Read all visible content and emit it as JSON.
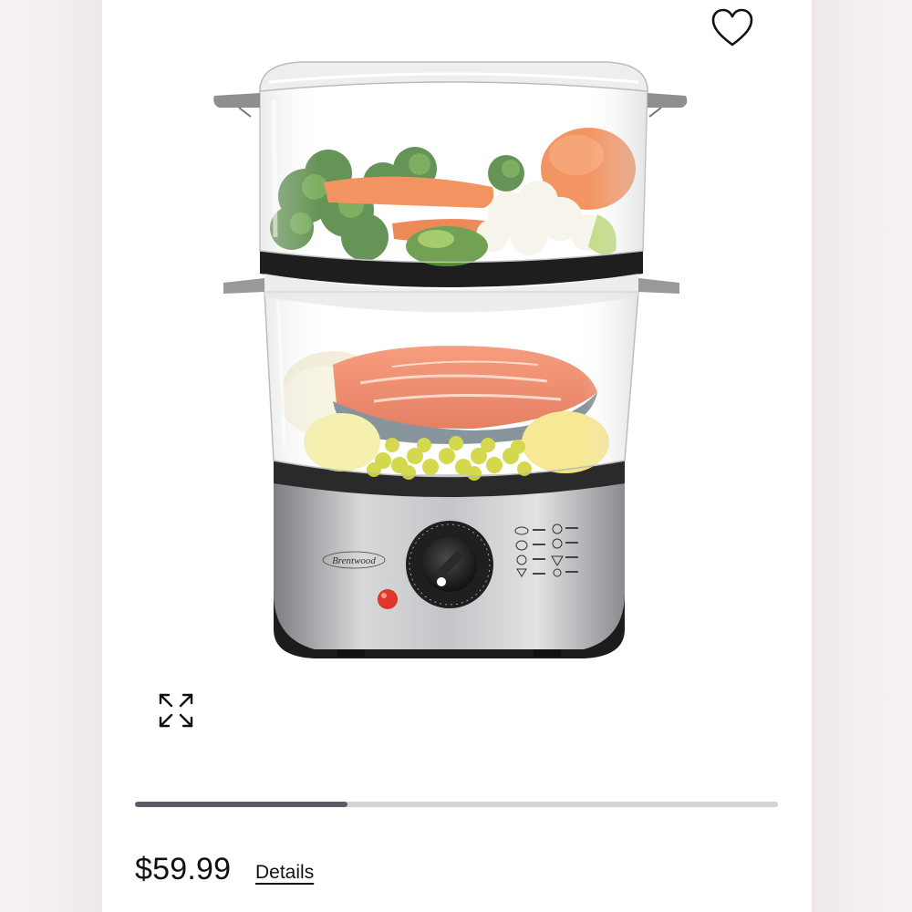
{
  "product": {
    "price": "$59.99",
    "details_label": "Details",
    "brand_text": "Brentwood",
    "image_progress_fraction": 0.33
  },
  "icons": {
    "favorite": "heart-outline-icon",
    "fullscreen": "expand-arrows-icon"
  },
  "colors": {
    "progress_fill": "#5b5b63",
    "progress_track": "#d4d4d6",
    "text": "#111111"
  }
}
